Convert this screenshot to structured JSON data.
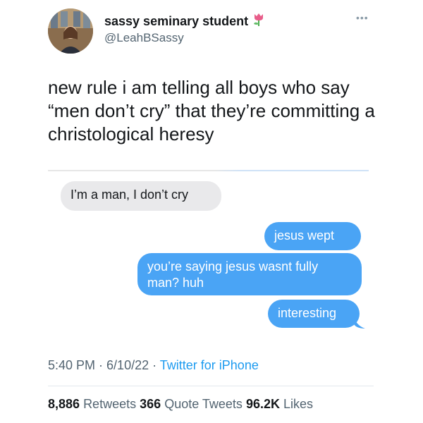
{
  "author": {
    "display_name": "sassy seminary student",
    "emoji": "🌷",
    "handle": "@LeahBSassy"
  },
  "tweet": {
    "text": "new rule i am telling all boys who say “men don’t cry” that they’re committing a christological heresy"
  },
  "messages": [
    {
      "side": "received",
      "text": "I’m a man, I don’t cry"
    },
    {
      "side": "sent",
      "text": "jesus wept"
    },
    {
      "side": "sent",
      "text": "you’re saying jesus wasnt fully man? huh"
    },
    {
      "side": "sent",
      "text": "interesting"
    }
  ],
  "meta": {
    "time": "5:40 PM",
    "sep1": " · ",
    "date": "6/10/22",
    "sep2": " · ",
    "source": "Twitter for iPhone"
  },
  "stats": {
    "retweets_count": "8,886",
    "retweets_label": "Retweets",
    "quotes_count": "366",
    "quotes_label": "Quote Tweets",
    "likes_count": "96.2K",
    "likes_label": "Likes"
  },
  "colors": {
    "sent_bubble": "#4aa4f5",
    "received_bubble": "#e9e9eb",
    "link": "#1d9bf0"
  },
  "icons": [
    "more-icon",
    "tulip-emoji"
  ]
}
